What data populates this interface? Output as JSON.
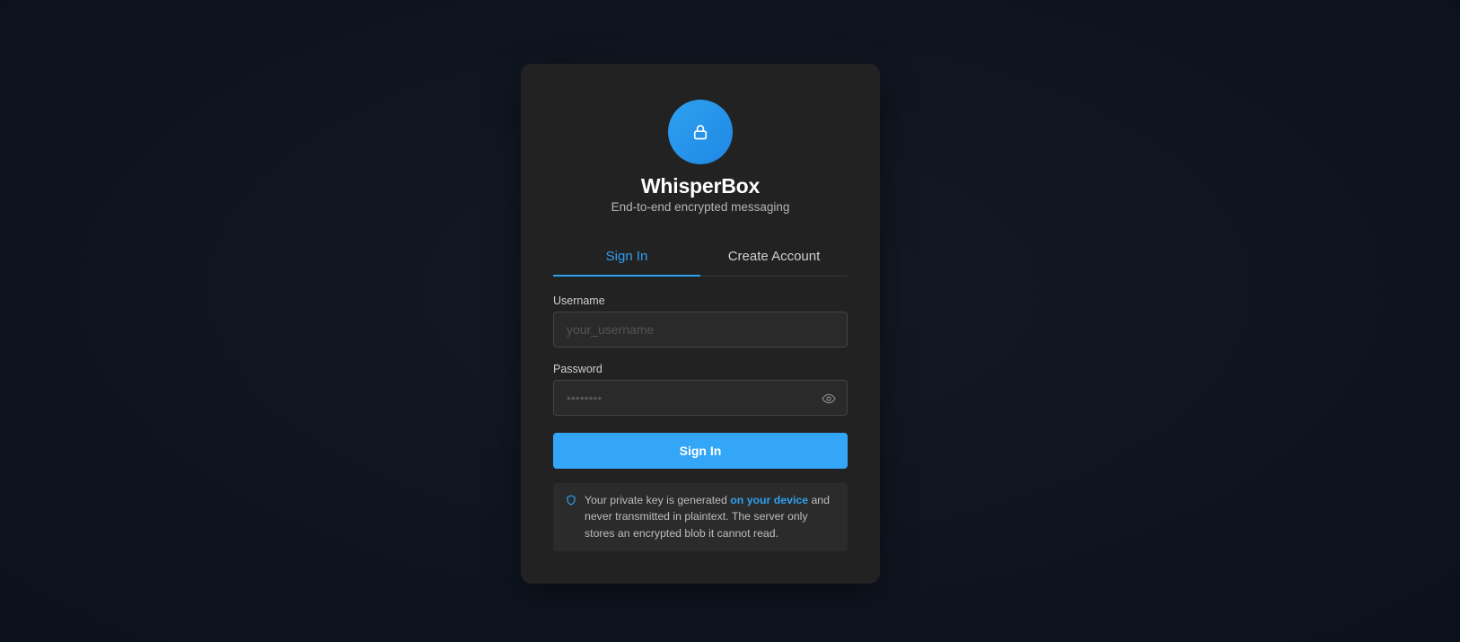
{
  "app": {
    "name": "WhisperBox",
    "tagline": "End-to-end encrypted messaging"
  },
  "tabs": [
    {
      "label": "Sign In",
      "active": true
    },
    {
      "label": "Create Account",
      "active": false
    }
  ],
  "form": {
    "username_label": "Username",
    "username_placeholder": "your_username",
    "username_value": "",
    "password_label": "Password",
    "password_placeholder": "••••••••",
    "password_value": "",
    "submit_label": "Sign In"
  },
  "notice": {
    "text_before": "Your private key is generated ",
    "highlight": "on your device",
    "text_after": " and never transmitted in plaintext. The server only stores an encrypted blob it cannot read."
  },
  "icons": {
    "logo": "lock-icon",
    "password_toggle": "eye-icon",
    "notice": "shield-icon"
  },
  "colors": {
    "accent": "#2ea1f0",
    "button": "#33a6f8",
    "card": "#222222",
    "background": "#0f1520"
  }
}
